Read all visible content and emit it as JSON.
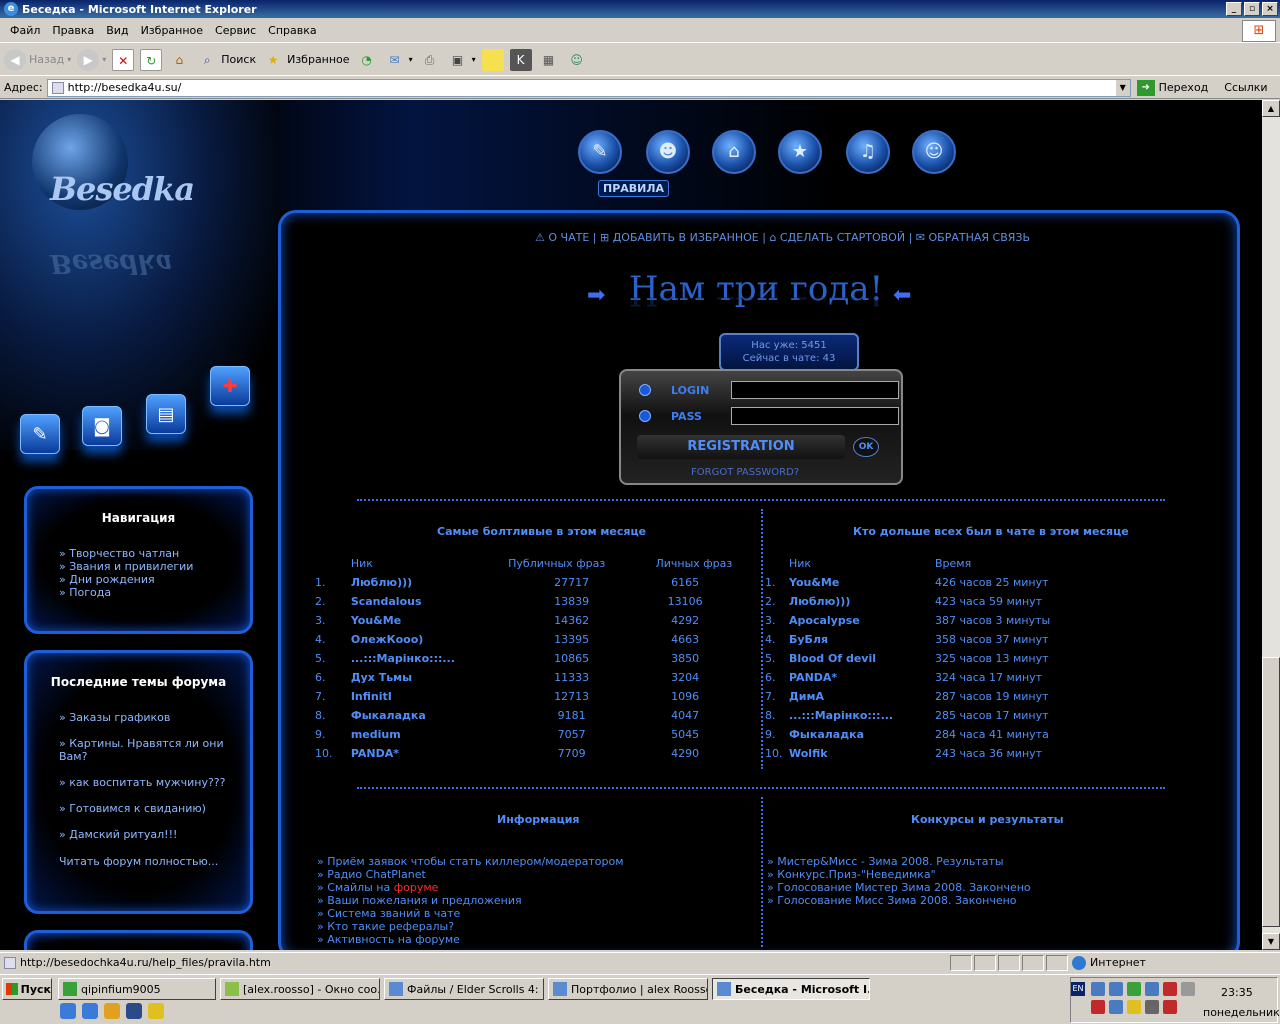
{
  "window": {
    "title": "Беседка - Microsoft Internet Explorer",
    "buttons": [
      "_",
      "▫",
      "×"
    ]
  },
  "menu": [
    "Файл",
    "Правка",
    "Вид",
    "Избранное",
    "Сервис",
    "Справка"
  ],
  "toolbar": {
    "back": "Назад",
    "search": "Поиск",
    "favorites": "Избранное"
  },
  "address": {
    "label": "Адрес:",
    "url": "http://besedka4u.su/",
    "go": "Переход",
    "links": "Ссылки"
  },
  "site": {
    "logo": "Besedka",
    "rules_label": "ПРАВИЛА",
    "topnav": [
      "О ЧАТЕ",
      "ДОБАВИТЬ В ИЗБРАННОЕ",
      "СДЕЛАТЬ СТАРТОВОЙ",
      "ОБРАТНАЯ СВЯЗЬ"
    ],
    "banner": "Нам три года!",
    "counter": {
      "total": "Нас уже: 5451",
      "online": "Сейчас в чате: 43"
    },
    "login": {
      "login_label": "LOGIN",
      "pass_label": "PASS",
      "registration": "REGISTRATION",
      "ok": "OK",
      "forgot": "FORGOT PASSWORD?"
    },
    "nav_panel": {
      "title": "Навигация",
      "items": [
        "» Творчество чатлан",
        "» Звания и привилегии",
        "» Дни рождения",
        "» Погода"
      ]
    },
    "forum_panel": {
      "title": "Последние темы форума",
      "items": [
        "» Заказы графиков",
        "» Картины. Нравятся ли они Вам?",
        "» как воспитать мужчину???",
        "» Готовимся к свиданию)",
        "» Дамский ритуал!!!"
      ],
      "read_all": "Читать форум полностью..."
    },
    "talkers": {
      "title": "Самые болтливые в этом месяце",
      "headers": [
        "Ник",
        "Публичных фраз",
        "Личных фраз"
      ],
      "rows": [
        {
          "n": "1.",
          "nick": "Люблю)))",
          "pub": "27717",
          "priv": "6165"
        },
        {
          "n": "2.",
          "nick": "Scandalous",
          "pub": "13839",
          "priv": "13106"
        },
        {
          "n": "3.",
          "nick": "You&Me",
          "pub": "14362",
          "priv": "4292"
        },
        {
          "n": "4.",
          "nick": "ОлежКооо)",
          "pub": "13395",
          "priv": "4663"
        },
        {
          "n": "5.",
          "nick": "...:::Марінко:::...",
          "pub": "10865",
          "priv": "3850"
        },
        {
          "n": "6.",
          "nick": "Дух Тьмы",
          "pub": "11333",
          "priv": "3204"
        },
        {
          "n": "7.",
          "nick": "InfinitI",
          "pub": "12713",
          "priv": "1096"
        },
        {
          "n": "8.",
          "nick": "Фыкаладка",
          "pub": "9181",
          "priv": "4047"
        },
        {
          "n": "9.",
          "nick": "medium",
          "pub": "7057",
          "priv": "5045"
        },
        {
          "n": "10.",
          "nick": "PANDA*",
          "pub": "7709",
          "priv": "4290"
        }
      ]
    },
    "longest": {
      "title": "Кто дольше всех был в чате в этом месяце",
      "headers": [
        "Ник",
        "Время"
      ],
      "rows": [
        {
          "n": "1.",
          "nick": "You&Me",
          "time": "426 часов 25 минут"
        },
        {
          "n": "2.",
          "nick": "Люблю)))",
          "time": "423 часа 59 минут"
        },
        {
          "n": "3.",
          "nick": "Apocalypse",
          "time": "387 часов 3 минуты"
        },
        {
          "n": "4.",
          "nick": "БуБля",
          "time": "358 часов 37 минут"
        },
        {
          "n": "5.",
          "nick": "Blood Of devil",
          "time": "325 часов 13 минут"
        },
        {
          "n": "6.",
          "nick": "PANDA*",
          "time": "324 часа 17 минут"
        },
        {
          "n": "7.",
          "nick": "ДимА",
          "time": "287 часов 19 минут"
        },
        {
          "n": "8.",
          "nick": "...:::Марінко:::...",
          "time": "285 часов 17 минут"
        },
        {
          "n": "9.",
          "nick": "Фыкаладка",
          "time": "284 часа 41 минута"
        },
        {
          "n": "10.",
          "nick": "Wolfik",
          "time": "243 часа 36 минут"
        }
      ]
    },
    "info": {
      "title": "Информация",
      "items": [
        "» Приём заявок чтобы стать киллером/модератором",
        "» Радио ChatPlanet",
        "» Смайлы на ",
        "» Ваши пожелания и предложения",
        "» Система званий в чате",
        "» Кто такие рефералы?",
        "» Активность на форуме"
      ],
      "forum_word": "форуме"
    },
    "contests": {
      "title": "Конкурсы и результаты",
      "items": [
        "» Мистер&Мисс - Зима 2008. Результаты",
        "» Конкурс.Приз-\"Неведимка\"",
        "» Голосование Мистер Зима 2008. Закончено",
        "» Голосование Мисс Зима 2008. Закончено"
      ]
    }
  },
  "status": {
    "url": "http://besedochka4u.ru/help_files/pravila.htm",
    "zone": "Интернет"
  },
  "taskbar": {
    "start": "Пуск",
    "tasks": [
      "qipinfium9005",
      "[alex.roosso] - Окно соо...",
      "Файлы / Elder Scrolls 4: ...",
      "Портфолио | alex Roosso...",
      "Беседка - Microsoft I..."
    ],
    "lang": "EN",
    "time": "23:35",
    "day": "понедельник"
  }
}
